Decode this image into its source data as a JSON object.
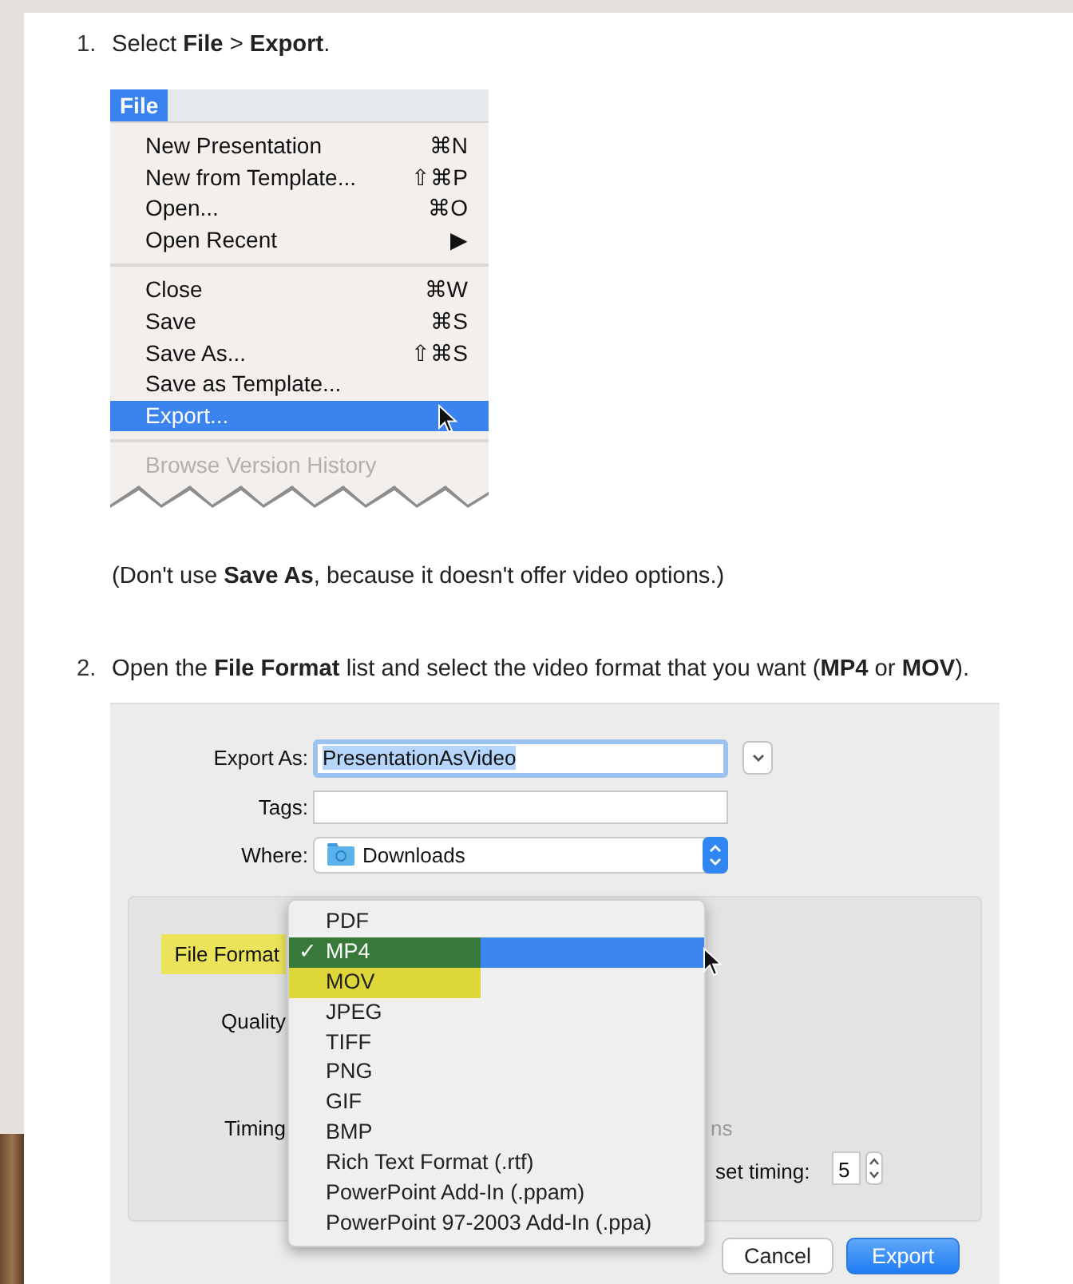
{
  "step_1": {
    "number": "1.",
    "text": "Select **File** > **Export**."
  },
  "file_menu": {
    "title": "File",
    "items": [
      {
        "kind": "item",
        "label": "New Presentation",
        "shortcut": "⌘N",
        "selected": false,
        "disabled": false
      },
      {
        "kind": "item",
        "label": "New from Template...",
        "shortcut": "⇧⌘P",
        "selected": false,
        "disabled": false
      },
      {
        "kind": "item",
        "label": "Open...",
        "shortcut": "⌘O",
        "selected": false,
        "disabled": false
      },
      {
        "kind": "item",
        "label": "Open Recent",
        "shortcut": "▶",
        "selected": false,
        "disabled": false
      },
      {
        "kind": "separator"
      },
      {
        "kind": "item",
        "label": "Close",
        "shortcut": "⌘W",
        "selected": false,
        "disabled": false
      },
      {
        "kind": "item",
        "label": "Save",
        "shortcut": "⌘S",
        "selected": false,
        "disabled": false
      },
      {
        "kind": "item",
        "label": "Save As...",
        "shortcut": "⇧⌘S",
        "selected": false,
        "disabled": false
      },
      {
        "kind": "item",
        "label": "Save as Template...",
        "selected": false,
        "disabled": false
      },
      {
        "kind": "item",
        "label": "Export...",
        "selected": true,
        "disabled": false
      },
      {
        "kind": "separator"
      },
      {
        "kind": "item",
        "label": "Browse Version History",
        "selected": false,
        "disabled": true
      }
    ]
  },
  "note": "(Don't use **Save As**, because it doesn't offer video options.)",
  "step_2": {
    "number": "2.",
    "text": "Open the **File Format** list and select the video format that you want (**MP4** or **MOV**)."
  },
  "export_dialog": {
    "export_as": {
      "label": "Export As:",
      "value": "PresentationAsVideo"
    },
    "tags": {
      "label": "Tags:"
    },
    "where": {
      "label": "Where:",
      "value": "Downloads"
    },
    "file_format": {
      "label": "File Format",
      "highlighted": true
    },
    "quality": {
      "label": "Quality"
    },
    "timing": {
      "label": "Timing",
      "hidden_text": "ns",
      "set_timing_label": "set timing:",
      "set_timing_value": "5"
    },
    "check_mark": "✓",
    "format_menu": [
      {
        "label": "PDF",
        "selected": false,
        "highlighted": false
      },
      {
        "label": "MP4",
        "selected": true,
        "highlighted": true
      },
      {
        "label": "MOV",
        "selected": false,
        "highlighted": true
      },
      {
        "label": "JPEG",
        "selected": false,
        "highlighted": false
      },
      {
        "label": "TIFF",
        "selected": false,
        "highlighted": false
      },
      {
        "label": "PNG",
        "selected": false,
        "highlighted": false
      },
      {
        "label": "GIF",
        "selected": false,
        "highlighted": false
      },
      {
        "label": "BMP",
        "selected": false,
        "highlighted": false
      },
      {
        "label": "Rich Text Format (.rtf)",
        "selected": false,
        "highlighted": false
      },
      {
        "label": "PowerPoint Add-In (.ppam)",
        "selected": false,
        "highlighted": false
      },
      {
        "label": "PowerPoint 97-2003 Add-In (.ppa)",
        "selected": false,
        "highlighted": false
      }
    ],
    "buttons": [
      {
        "kind": "secondary",
        "label": "Cancel"
      },
      {
        "kind": "primary",
        "label": "Export"
      }
    ]
  }
}
